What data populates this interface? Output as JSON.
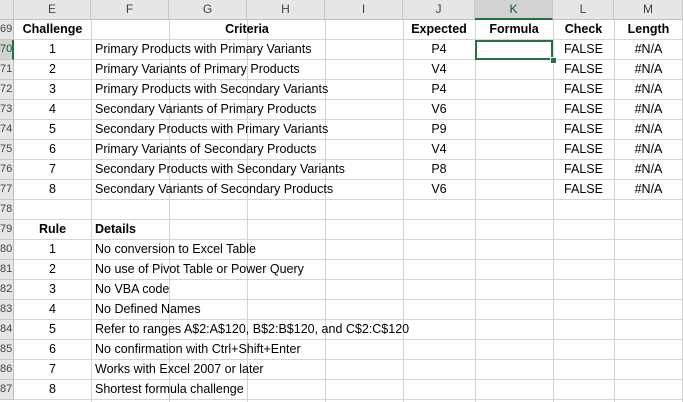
{
  "column_headers": [
    "E",
    "F",
    "G",
    "H",
    "I",
    "J",
    "K",
    "L",
    "M"
  ],
  "row_numbers": [
    "69",
    "70",
    "71",
    "72",
    "73",
    "74",
    "75",
    "76",
    "77",
    "78",
    "79",
    "80",
    "81",
    "82",
    "83",
    "84",
    "85",
    "86",
    "87"
  ],
  "header_row": {
    "challenge": "Challenge",
    "criteria": "Criteria",
    "expected": "Expected",
    "formula": "Formula",
    "check": "Check",
    "length": "Length"
  },
  "challenges": [
    {
      "n": "1",
      "criteria": "Primary Products with Primary Variants",
      "expected": "P4",
      "formula": "",
      "check": "FALSE",
      "length": "#N/A"
    },
    {
      "n": "2",
      "criteria": "Primary Variants of Primary Products",
      "expected": "V4",
      "formula": "",
      "check": "FALSE",
      "length": "#N/A"
    },
    {
      "n": "3",
      "criteria": "Primary Products with Secondary Variants",
      "expected": "P4",
      "formula": "",
      "check": "FALSE",
      "length": "#N/A"
    },
    {
      "n": "4",
      "criteria": "Secondary Variants of Primary Products",
      "expected": "V6",
      "formula": "",
      "check": "FALSE",
      "length": "#N/A"
    },
    {
      "n": "5",
      "criteria": "Secondary Products with Primary Variants",
      "expected": "P9",
      "formula": "",
      "check": "FALSE",
      "length": "#N/A"
    },
    {
      "n": "6",
      "criteria": "Primary Variants of Secondary Products",
      "expected": "V4",
      "formula": "",
      "check": "FALSE",
      "length": "#N/A"
    },
    {
      "n": "7",
      "criteria": "Secondary Products with Secondary Variants",
      "expected": "P8",
      "formula": "",
      "check": "FALSE",
      "length": "#N/A"
    },
    {
      "n": "8",
      "criteria": "Secondary Variants of Secondary Products",
      "expected": "V6",
      "formula": "",
      "check": "FALSE",
      "length": "#N/A"
    }
  ],
  "rules_header": {
    "rule": "Rule",
    "details": "Details"
  },
  "rules": [
    {
      "n": "1",
      "details": "No conversion to Excel Table"
    },
    {
      "n": "2",
      "details": "No use of Pivot Table or Power Query"
    },
    {
      "n": "3",
      "details": "No VBA code"
    },
    {
      "n": "4",
      "details": "No Defined Names"
    },
    {
      "n": "5",
      "details": "Refer to ranges A$2:A$120, B$2:B$120, and C$2:C$120"
    },
    {
      "n": "6",
      "details": "No confirmation with Ctrl+Shift+Enter"
    },
    {
      "n": "7",
      "details": "Works with Excel 2007 or later"
    },
    {
      "n": "8",
      "details": "Shortest formula challenge"
    }
  ],
  "selected_cell": "K70",
  "colors": {
    "accent": "#217346",
    "header_bg": "#e6e6e6",
    "gridline": "#d4d4d4"
  }
}
